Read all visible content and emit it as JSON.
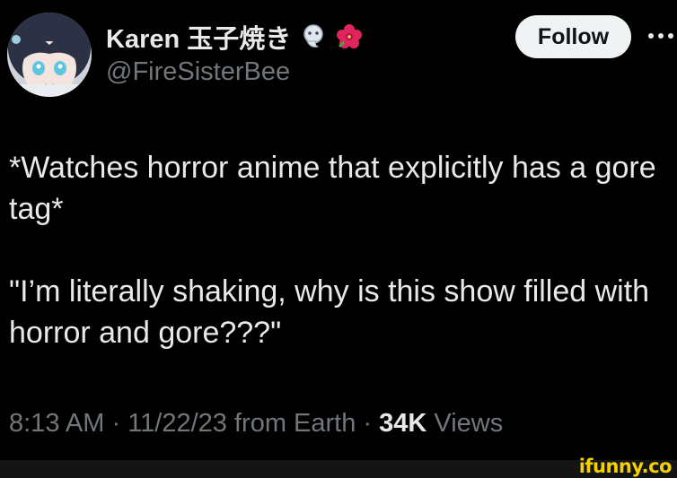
{
  "tweet": {
    "author": {
      "display_name": "Karen 玉子焼き",
      "handle": "@FireSisterBee",
      "badges": [
        "ghost-badge-icon",
        "hibiscus-flower-icon"
      ]
    },
    "follow_label": "Follow",
    "more_icon": "more-options-icon",
    "body": {
      "paragraph_1": "*Watches horror anime that explicitly has a gore tag*",
      "paragraph_2": "\"I’m literally shaking, why is this show filled with horror and gore???\""
    },
    "meta": {
      "time": "8:13 AM",
      "sep1": " · ",
      "date": "11/22/23",
      "source": " from Earth",
      "sep2": " · ",
      "views_count": "34K",
      "views_label": " Views"
    }
  },
  "watermark": {
    "text": "ifunny.co"
  },
  "colors": {
    "background": "#000000",
    "primary_text": "#e7e9ea",
    "secondary_text": "#71767b",
    "follow_bg": "#eff3f4",
    "watermark": "#f5d000"
  }
}
